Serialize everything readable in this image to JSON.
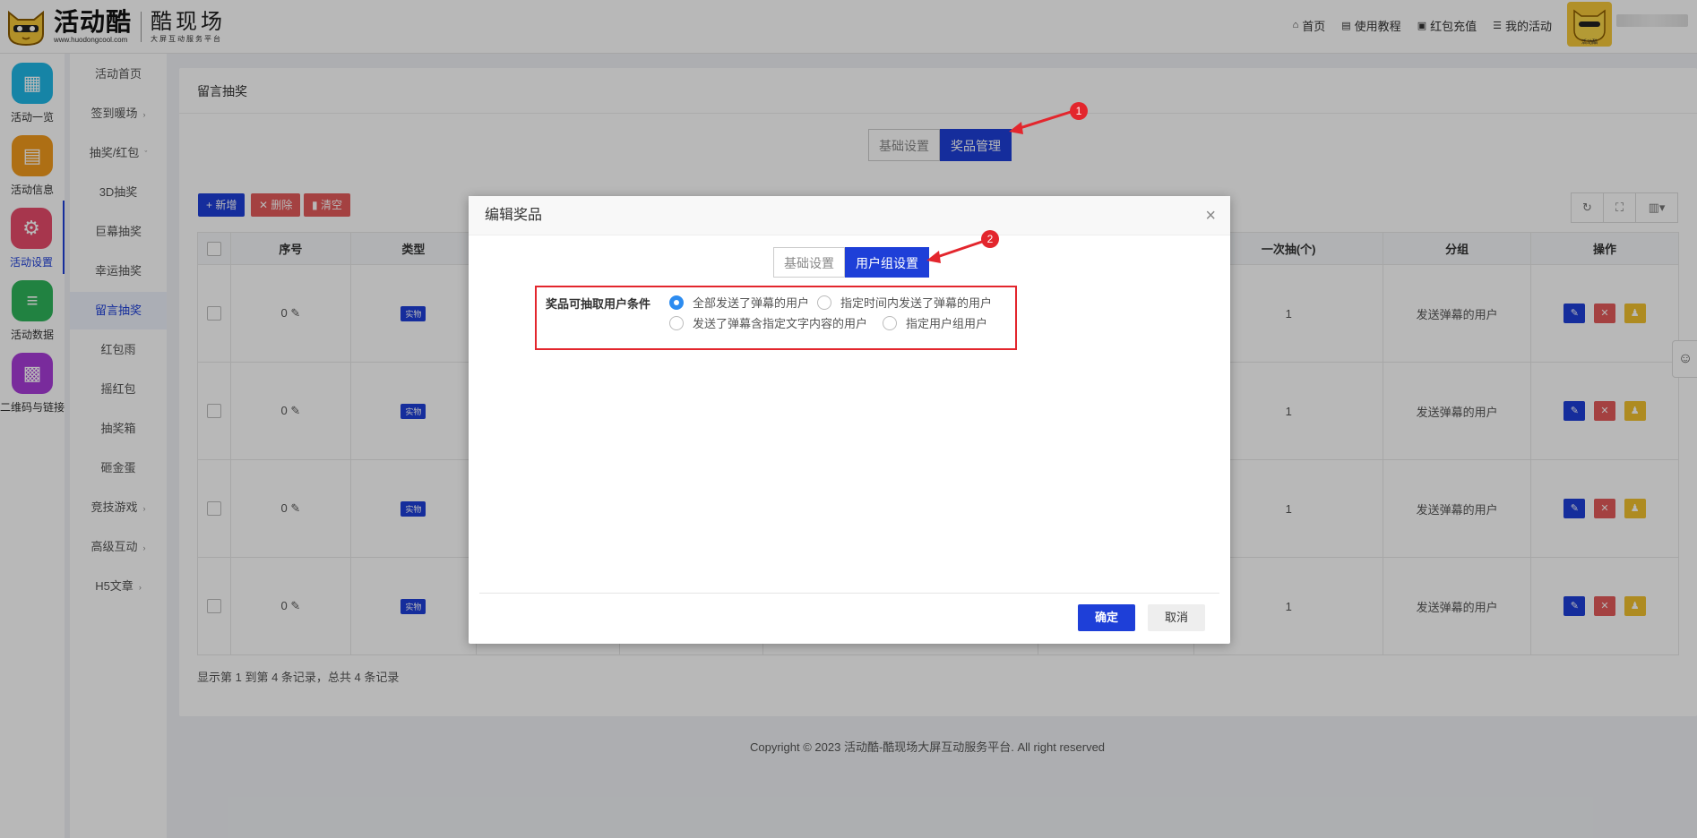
{
  "brand": {
    "name": "活动酷",
    "url": "www.huodongcool.com",
    "sub_name": "酷现场",
    "sub_tagline": "大屏互动服务平台",
    "avatar_caption": "活动酷"
  },
  "topnav": [
    {
      "label": "首页",
      "icon": "home-icon"
    },
    {
      "label": "使用教程",
      "icon": "book-icon"
    },
    {
      "label": "红包充值",
      "icon": "wallet-icon"
    },
    {
      "label": "我的活动",
      "icon": "list-icon"
    }
  ],
  "iconbar": [
    {
      "label": "活动一览",
      "color": "#1fb8e6",
      "icon": "grid-icon"
    },
    {
      "label": "活动信息",
      "color": "#f29a1c",
      "icon": "document-icon"
    },
    {
      "label": "活动设置",
      "color": "#e84c6b",
      "icon": "gear-icon"
    },
    {
      "label": "活动数据",
      "color": "#2fb55a",
      "icon": "database-icon"
    },
    {
      "label": "二维码与链接",
      "color": "#a83cd8",
      "icon": "qrcode-icon"
    }
  ],
  "submenu": [
    {
      "label": "活动首页",
      "chev": ""
    },
    {
      "label": "签到暖场",
      "chev": "›"
    },
    {
      "label": "抽奖/红包",
      "chev": "ˇ"
    },
    {
      "label": "3D抽奖",
      "chev": ""
    },
    {
      "label": "巨幕抽奖",
      "chev": ""
    },
    {
      "label": "幸运抽奖",
      "chev": ""
    },
    {
      "label": "留言抽奖",
      "chev": ""
    },
    {
      "label": "红包雨",
      "chev": ""
    },
    {
      "label": "摇红包",
      "chev": ""
    },
    {
      "label": "抽奖箱",
      "chev": ""
    },
    {
      "label": "砸金蛋",
      "chev": ""
    },
    {
      "label": "竞技游戏",
      "chev": "›"
    },
    {
      "label": "高级互动",
      "chev": "›"
    },
    {
      "label": "H5文章",
      "chev": "›"
    }
  ],
  "panel": {
    "title": "留言抽奖",
    "tabs": [
      "基础设置",
      "奖品管理"
    ],
    "toolbar": {
      "add": "新增",
      "delete": "删除",
      "clear": "清空"
    },
    "table_headers": [
      "序号",
      "类型",
      "一次抽(个)",
      "分组",
      "操作"
    ],
    "rows": [
      {
        "seq": "0",
        "type": "实物",
        "per_draw": "1",
        "group": "发送弹幕的用户"
      },
      {
        "seq": "0",
        "type": "实物",
        "per_draw": "1",
        "group": "发送弹幕的用户"
      },
      {
        "seq": "0",
        "type": "实物",
        "per_draw": "1",
        "group": "发送弹幕的用户"
      },
      {
        "seq": "0",
        "type": "实物",
        "per_draw": "1",
        "group": "发送弹幕的用户"
      }
    ],
    "pager_info": "显示第 1 到第 4 条记录，总共 4 条记录"
  },
  "footer": "Copyright © 2023 活动酷-酷现场大屏互动服务平台. All right reserved",
  "modal": {
    "title": "编辑奖品",
    "tabs": [
      "基础设置",
      "用户组设置"
    ],
    "condition_label": "奖品可抽取用户条件",
    "options": [
      {
        "label": "全部发送了弹幕的用户",
        "checked": true
      },
      {
        "label": "指定时间内发送了弹幕的用户",
        "checked": false
      },
      {
        "label": "发送了弹幕含指定文字内容的用户",
        "checked": false
      },
      {
        "label": "指定用户组用户",
        "checked": false
      }
    ],
    "confirm": "确定",
    "cancel": "取消"
  },
  "annotations": [
    "1",
    "2"
  ],
  "colors": {
    "primary": "#1e3fd8",
    "danger": "#e35a5a",
    "warning": "#f2c12e",
    "annotation": "#e3262d"
  }
}
